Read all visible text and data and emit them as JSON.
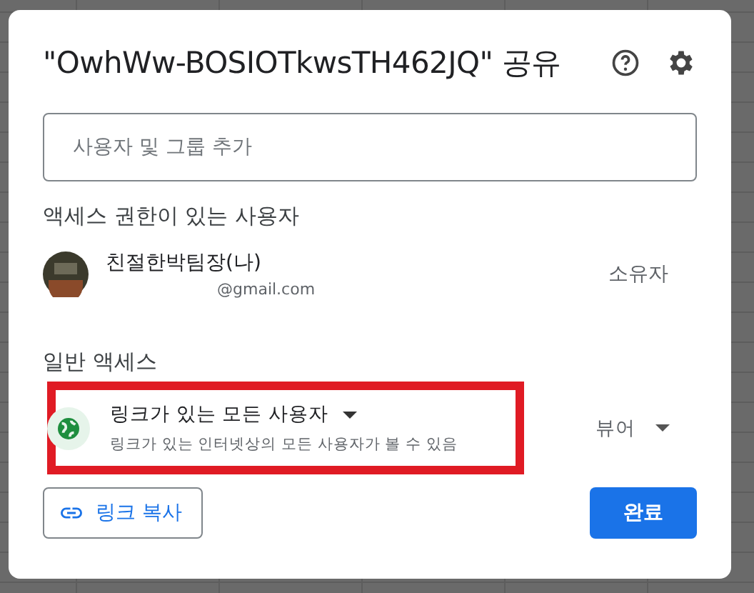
{
  "dialog": {
    "title": "\"OwhWw-BOSIOTkwsTH462JQ\" 공유",
    "add_field": {
      "placeholder": "사용자 및 그룹 추가"
    },
    "people_heading": "액세스 권한이 있는 사용자",
    "people": [
      {
        "name": "친절한박팀장(나)",
        "email": "@gmail.com",
        "role": "소유자"
      }
    ],
    "general_heading": "일반 액세스",
    "general_access": {
      "option": "링크가 있는 모든 사용자",
      "description": "링크가 있는 인터넷상의 모든 사용자가 볼 수 있음",
      "role": "뷰어",
      "highlighted": true
    },
    "buttons": [
      {
        "kind": "outline",
        "label": "링크 복사"
      },
      {
        "kind": "primary",
        "label": "완료"
      }
    ]
  }
}
